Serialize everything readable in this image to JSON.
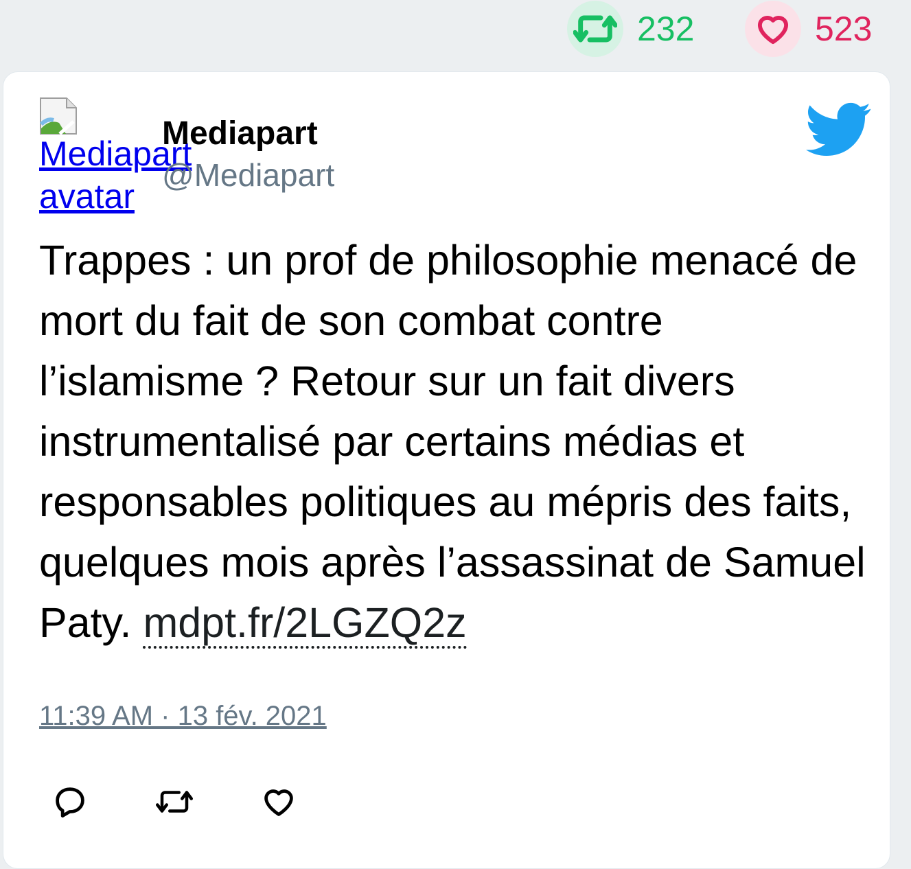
{
  "stats": {
    "retweet_count": "232",
    "like_count": "523",
    "retweet_color": "#17bf63",
    "like_color": "#e0245e"
  },
  "tweet": {
    "avatar_alt": "Mediapart avatar",
    "display_name": "Mediapart",
    "handle": "@Mediapart",
    "text": "Trappes : un prof de philosophie menacé de mort du fait de son combat contre l’islamisme ? Retour sur un fait divers instrumentalisé par certains médias et responsables politiques au mépris des faits, quelques mois après l’assassinat de Samuel Paty. ",
    "link_text": "mdpt.fr/2LGZQ2z",
    "timestamp": "11:39 AM · 13 fév. 2021"
  },
  "icons": {
    "brand": "twitter-bird-icon",
    "actions": [
      "reply-icon",
      "retweet-icon",
      "like-icon"
    ]
  },
  "colors": {
    "twitter_blue": "#1da1f2",
    "handle_gray": "#657786"
  }
}
